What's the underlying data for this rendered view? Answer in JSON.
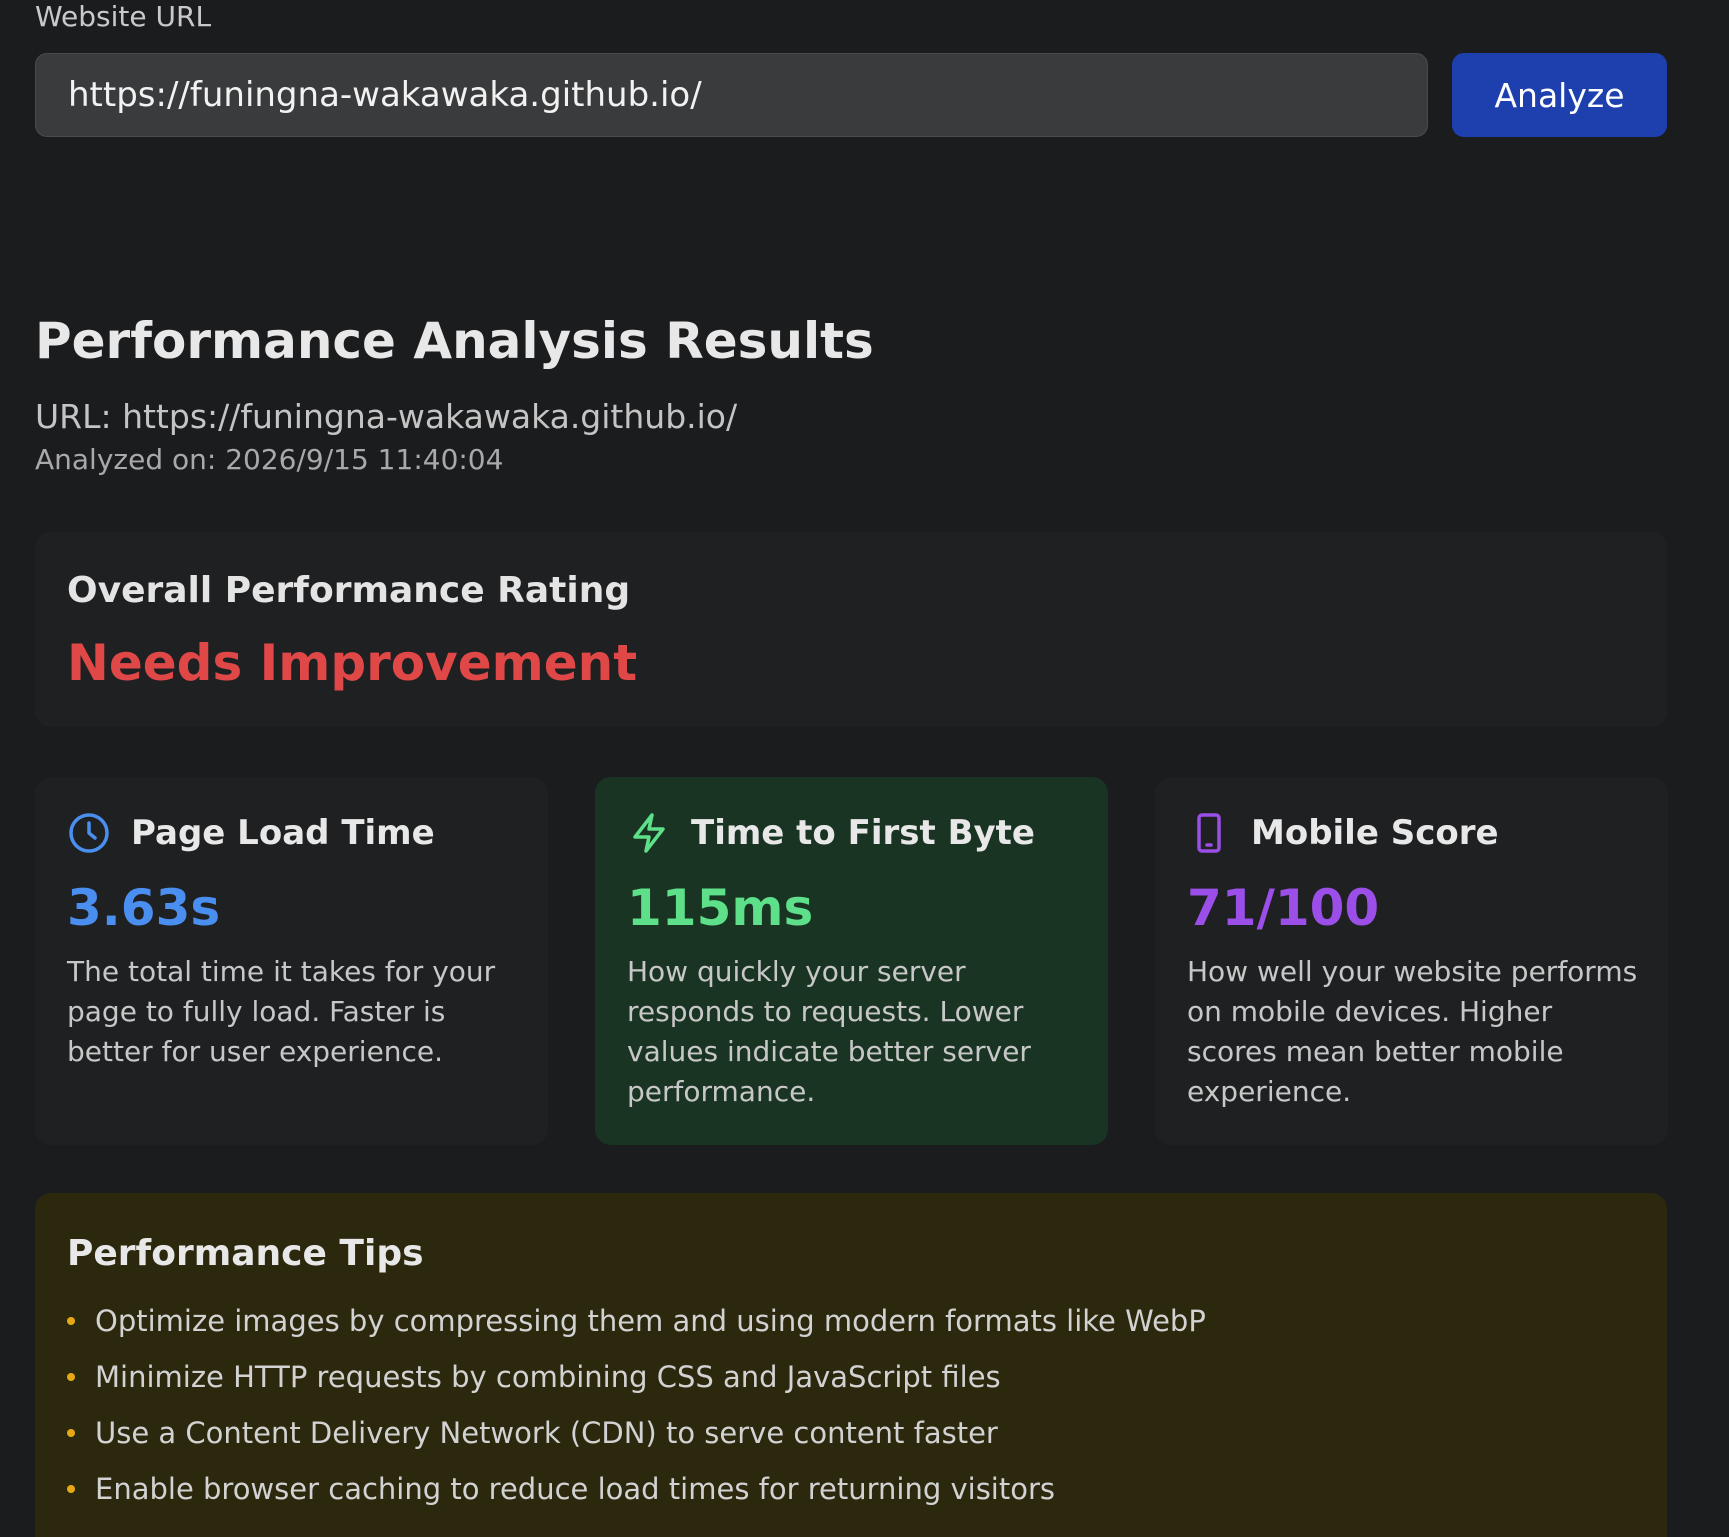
{
  "form": {
    "url_label": "Website URL",
    "url_value": "https://funingna-wakawaka.github.io/",
    "analyze_label": "Analyze"
  },
  "results": {
    "title": "Performance Analysis Results",
    "url_line": "URL: https://funingna-wakawaka.github.io/",
    "analyzed_line": "Analyzed on: 2026/9/15 11:40:04"
  },
  "rating": {
    "label": "Overall Performance Rating",
    "value": "Needs Improvement",
    "color": "#e04848"
  },
  "metrics": [
    {
      "icon": "clock-icon",
      "title": "Page Load Time",
      "value": "3.63s",
      "color": "#4a8ff0",
      "description": "The total time it takes for your page to fully load. Faster is better for user experience."
    },
    {
      "icon": "lightning-icon",
      "title": "Time to First Byte",
      "value": "115ms",
      "color": "#5ee08a",
      "description": "How quickly your server responds to requests. Lower values indicate better server performance."
    },
    {
      "icon": "smartphone-icon",
      "title": "Mobile Score",
      "value": "71/100",
      "color": "#9b4fe8",
      "description": "How well your website performs on mobile devices. Higher scores mean better mobile experience."
    }
  ],
  "tips": {
    "title": "Performance Tips",
    "bullet_color": "#e6a817",
    "items": [
      "Optimize images by compressing them and using modern formats like WebP",
      "Minimize HTTP requests by combining CSS and JavaScript files",
      "Use a Content Delivery Network (CDN) to serve content faster",
      "Enable browser caching to reduce load times for returning visitors"
    ]
  }
}
